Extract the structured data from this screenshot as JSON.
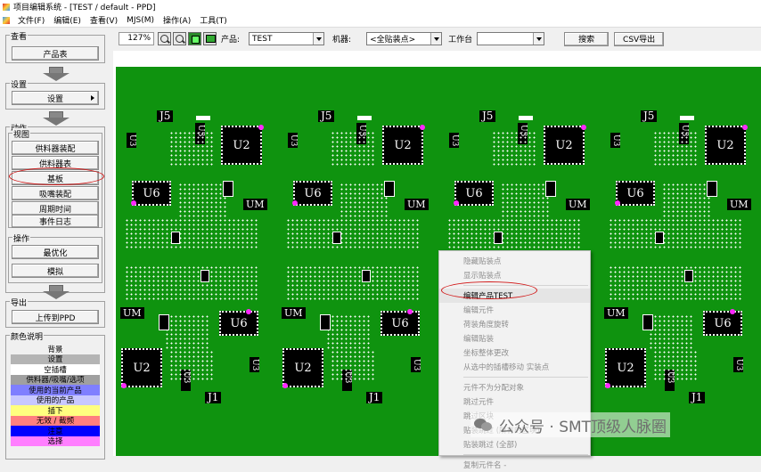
{
  "window": {
    "title": "项目编辑系统 - [TEST / default - PPD]"
  },
  "menu": [
    "文件(F)",
    "编辑(E)",
    "查看(V)",
    "MJS(M)",
    "操作(A)",
    "工具(T)"
  ],
  "left": {
    "view_group": {
      "title": "查看",
      "product_button": "产品表"
    },
    "settings_group": {
      "title": "设置",
      "settings_button": "设置"
    },
    "action_group": {
      "title": "动作"
    },
    "views_group": {
      "title": "视图",
      "buttons": [
        "供料器装配",
        "供料器表",
        "基板",
        "吸嘴装配",
        "周期时间",
        "事件日志"
      ]
    },
    "operation_group": {
      "title": "操作",
      "buttons": [
        "最优化",
        "模拟"
      ]
    },
    "export_group": {
      "title": "导出",
      "upload_button": "上传到PPD"
    },
    "legend": {
      "title": "颜色说明",
      "items": [
        {
          "label": "背景",
          "bg": "#f0f0f0",
          "fg": "#000000"
        },
        {
          "label": "设置",
          "bg": "#b4b4b4",
          "fg": "#000000"
        },
        {
          "label": "空插槽",
          "bg": "#ffffff",
          "fg": "#000000"
        },
        {
          "label": "供料器/吸嘴/选项",
          "bg": "#a0a0a0",
          "fg": "#000000"
        },
        {
          "label": "使用的当前产品",
          "bg": "#7f7fff",
          "fg": "#000000"
        },
        {
          "label": "使用的产品",
          "bg": "#c8c8ff",
          "fg": "#000000"
        },
        {
          "label": "插下",
          "bg": "#ffff7f",
          "fg": "#000000"
        },
        {
          "label": "无效 / 截频",
          "bg": "#ff7f7f",
          "fg": "#000000"
        },
        {
          "label": "注意",
          "bg": "#0000ff",
          "fg": "#000000"
        },
        {
          "label": "选择",
          "bg": "#ff7fff",
          "fg": "#000000"
        }
      ]
    }
  },
  "toolbar": {
    "zoom": "127%",
    "product_label": "产品:",
    "product_value": "TEST",
    "machine_label": "机器:",
    "machine_value": "<全贴装点>",
    "table_label": "工作台",
    "table_value": "",
    "search_button": "搜索",
    "csv_button": "CSV导出"
  },
  "board": {
    "color": "#0f930f",
    "labels": {
      "u2": "U2",
      "u6": "U6",
      "j5": "J5",
      "j1": "J1",
      "um": "UM",
      "u3": "U3"
    }
  },
  "context_menu": {
    "items": [
      {
        "label": "隐藏贴装点",
        "enabled": false
      },
      {
        "label": "显示贴装点",
        "enabled": false
      },
      {
        "sep": true
      },
      {
        "label": "编辑产品TEST",
        "enabled": true
      },
      {
        "label": "编辑元件",
        "enabled": false
      },
      {
        "label": "荷装角度旋转",
        "enabled": false
      },
      {
        "label": "编辑贴装",
        "enabled": false
      },
      {
        "label": "坐标整体更改",
        "enabled": false
      },
      {
        "label": "从选中的插槽移动  实装点",
        "enabled": false
      },
      {
        "sep": true
      },
      {
        "label": "元件不为分配对象",
        "enabled": false
      },
      {
        "label": "跳过元件",
        "enabled": false
      },
      {
        "label": "跳过区块",
        "enabled": false
      },
      {
        "label": "贴装跳过 (所有的区块)",
        "enabled": false
      },
      {
        "label": "贴装跳过 (全部)",
        "enabled": false
      },
      {
        "sep": true
      },
      {
        "label": "复制元件名 -",
        "enabled": false
      }
    ]
  },
  "watermark": "公众号 · SMT顶级人脉圈",
  "colors": {
    "highlight": "#d21818",
    "pad_marker": "#ff28ff"
  }
}
